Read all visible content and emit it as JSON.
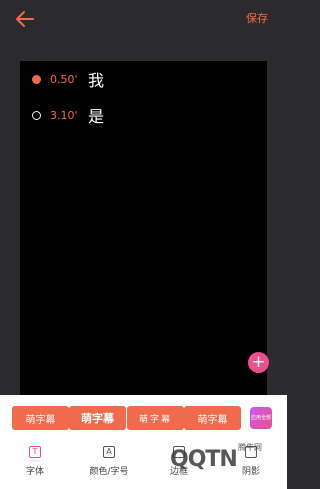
{
  "header": {
    "back_icon": "arrow-left-icon",
    "save_label": "保存",
    "accent_color": "#f06a4d"
  },
  "lyrics": [
    {
      "time": "0.50'",
      "text": "我",
      "active": true
    },
    {
      "time": "3.10'",
      "text": "是",
      "active": false
    }
  ],
  "fab_label": "+",
  "styles": [
    {
      "label": "萌字幕"
    },
    {
      "label": "萌字幕"
    },
    {
      "label": "萌字幕"
    },
    {
      "label": "萌字幕"
    }
  ],
  "apply_all_label": "应用全部",
  "tabs": [
    {
      "label": "字体",
      "icon": "T",
      "active": true
    },
    {
      "label": "颜色/字号",
      "icon": "A",
      "active": false
    },
    {
      "label": "边框",
      "icon": "",
      "active": false
    },
    {
      "label": "阴影",
      "icon": "",
      "active": false
    }
  ],
  "watermark": {
    "brand": "QQTN",
    "small": "腾牛网"
  }
}
